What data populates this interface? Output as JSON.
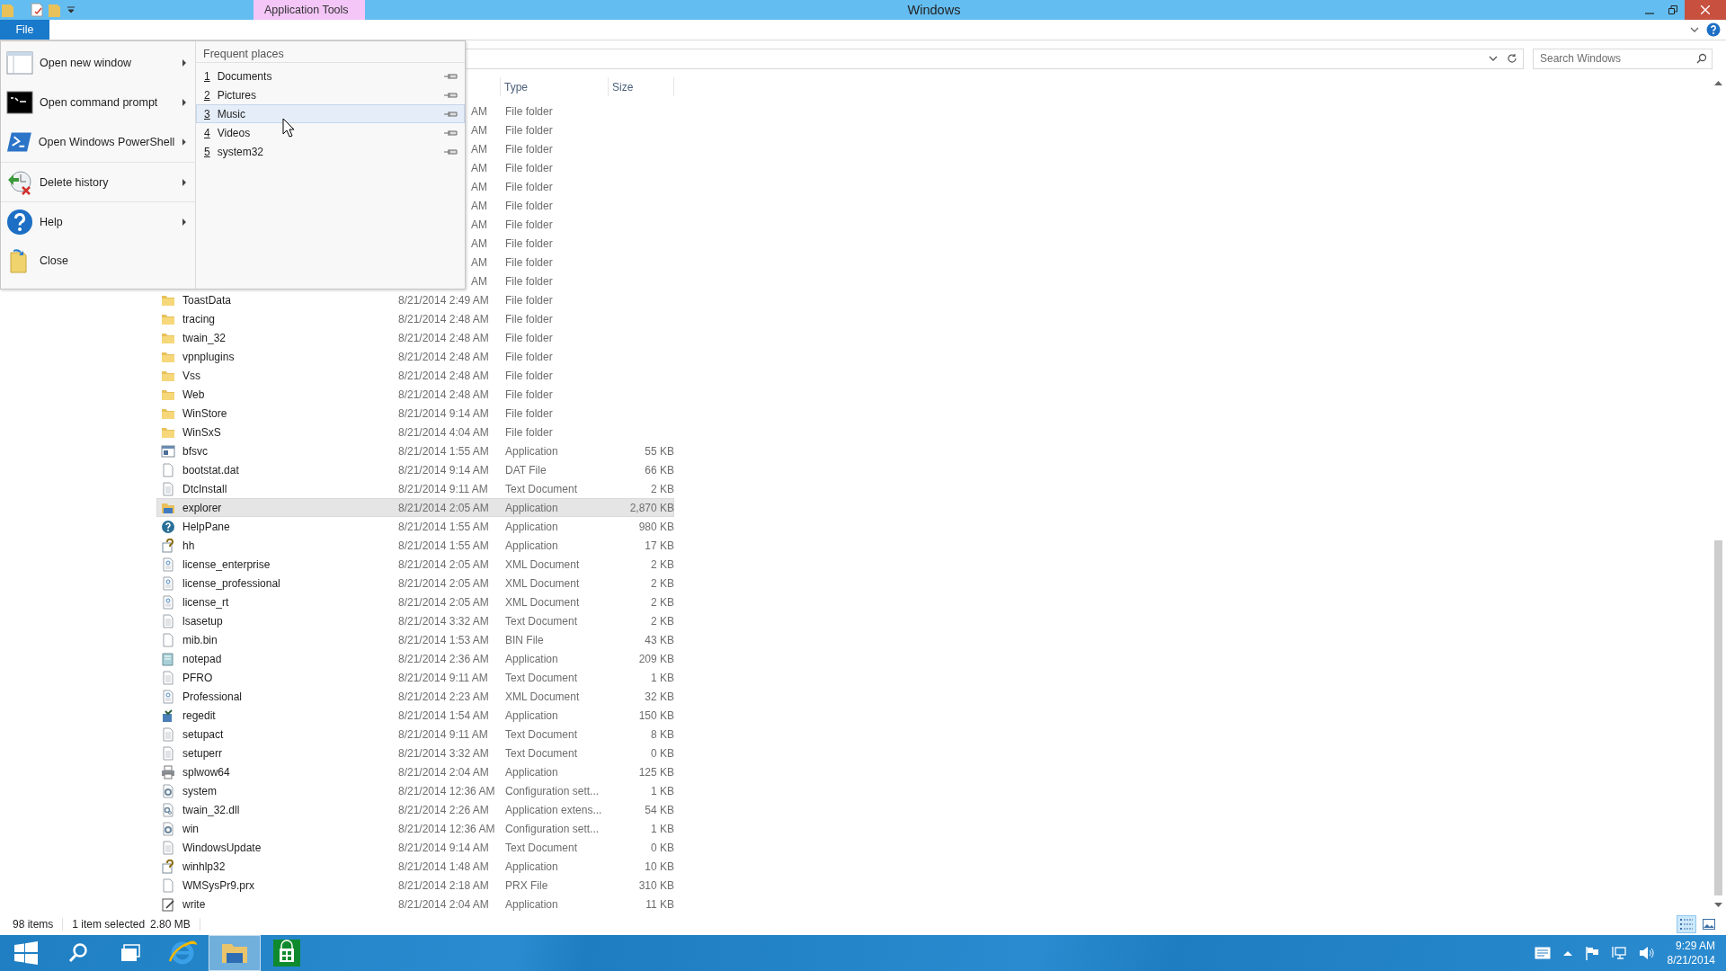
{
  "window": {
    "title": "Windows",
    "context_tab": "Application Tools"
  },
  "ribbon": {
    "file_tab": "File"
  },
  "search": {
    "placeholder": "Search Windows"
  },
  "columns": [
    {
      "label": "Type"
    },
    {
      "label": "Size"
    }
  ],
  "rows": [
    {
      "covered": true,
      "date": "AM",
      "type": "File folder",
      "selected": false
    },
    {
      "covered": true,
      "date": "AM",
      "type": "File folder",
      "selected": false
    },
    {
      "covered": true,
      "date": "AM",
      "type": "File folder",
      "selected": false
    },
    {
      "covered": true,
      "date": "AM",
      "type": "File folder",
      "selected": false
    },
    {
      "covered": true,
      "date": "AM",
      "type": "File folder",
      "selected": false
    },
    {
      "covered": true,
      "date": "AM",
      "type": "File folder",
      "selected": false
    },
    {
      "covered": true,
      "date": "AM",
      "type": "File folder",
      "selected": false
    },
    {
      "covered": true,
      "date": "AM",
      "type": "File folder",
      "selected": false
    },
    {
      "covered": true,
      "date": "AM",
      "type": "File folder",
      "selected": false
    },
    {
      "covered": true,
      "date": "AM",
      "type": "File folder",
      "selected": false
    },
    {
      "kind": "folder",
      "covered": false,
      "name": "ToastData",
      "date": "8/21/2014 2:49 AM",
      "type": "File folder",
      "selected": false
    },
    {
      "kind": "folder",
      "covered": false,
      "name": "tracing",
      "date": "8/21/2014 2:48 AM",
      "type": "File folder",
      "selected": false
    },
    {
      "kind": "folder",
      "covered": false,
      "name": "twain_32",
      "date": "8/21/2014 2:48 AM",
      "type": "File folder",
      "selected": false
    },
    {
      "kind": "folder",
      "covered": false,
      "name": "vpnplugins",
      "date": "8/21/2014 2:48 AM",
      "type": "File folder",
      "selected": false
    },
    {
      "kind": "folder",
      "covered": false,
      "name": "Vss",
      "date": "8/21/2014 2:48 AM",
      "type": "File folder",
      "selected": false
    },
    {
      "kind": "folder",
      "covered": false,
      "name": "Web",
      "date": "8/21/2014 2:48 AM",
      "type": "File folder",
      "selected": false
    },
    {
      "kind": "folder",
      "covered": false,
      "name": "WinStore",
      "date": "8/21/2014 9:14 AM",
      "type": "File folder",
      "selected": false
    },
    {
      "kind": "folder",
      "covered": false,
      "name": "WinSxS",
      "date": "8/21/2014 4:04 AM",
      "type": "File folder",
      "selected": false
    },
    {
      "kind": "app",
      "covered": false,
      "name": "bfsvc",
      "date": "8/21/2014 1:55 AM",
      "type": "Application",
      "size": "55 KB",
      "selected": false
    },
    {
      "kind": "blank",
      "covered": false,
      "name": "bootstat.dat",
      "date": "8/21/2014 9:14 AM",
      "type": "DAT File",
      "size": "66 KB",
      "selected": false
    },
    {
      "kind": "text",
      "covered": false,
      "name": "DtcInstall",
      "date": "8/21/2014 9:11 AM",
      "type": "Text Document",
      "size": "2 KB",
      "selected": false
    },
    {
      "kind": "explorer",
      "covered": false,
      "name": "explorer",
      "date": "8/21/2014 2:05 AM",
      "type": "Application",
      "size": "2,870 KB",
      "selected": true
    },
    {
      "kind": "help",
      "covered": false,
      "name": "HelpPane",
      "date": "8/21/2014 1:55 AM",
      "type": "Application",
      "size": "980 KB",
      "selected": false
    },
    {
      "kind": "hh",
      "covered": false,
      "name": "hh",
      "date": "8/21/2014 1:55 AM",
      "type": "Application",
      "size": "17 KB",
      "selected": false
    },
    {
      "kind": "xml",
      "covered": false,
      "name": "license_enterprise",
      "date": "8/21/2014 2:05 AM",
      "type": "XML Document",
      "size": "2 KB",
      "selected": false
    },
    {
      "kind": "xml",
      "covered": false,
      "name": "license_professional",
      "date": "8/21/2014 2:05 AM",
      "type": "XML Document",
      "size": "2 KB",
      "selected": false
    },
    {
      "kind": "xml",
      "covered": false,
      "name": "license_rt",
      "date": "8/21/2014 2:05 AM",
      "type": "XML Document",
      "size": "2 KB",
      "selected": false
    },
    {
      "kind": "text",
      "covered": false,
      "name": "lsasetup",
      "date": "8/21/2014 3:32 AM",
      "type": "Text Document",
      "size": "2 KB",
      "selected": false
    },
    {
      "kind": "blank",
      "covered": false,
      "name": "mib.bin",
      "date": "8/21/2014 1:53 AM",
      "type": "BIN File",
      "size": "43 KB",
      "selected": false
    },
    {
      "kind": "notepad",
      "covered": false,
      "name": "notepad",
      "date": "8/21/2014 2:36 AM",
      "type": "Application",
      "size": "209 KB",
      "selected": false
    },
    {
      "kind": "text",
      "covered": false,
      "name": "PFRO",
      "date": "8/21/2014 9:11 AM",
      "type": "Text Document",
      "size": "1 KB",
      "selected": false
    },
    {
      "kind": "xml",
      "covered": false,
      "name": "Professional",
      "date": "8/21/2014 2:23 AM",
      "type": "XML Document",
      "size": "32 KB",
      "selected": false
    },
    {
      "kind": "registry",
      "covered": false,
      "name": "regedit",
      "date": "8/21/2014 1:54 AM",
      "type": "Application",
      "size": "150 KB",
      "selected": false
    },
    {
      "kind": "text",
      "covered": false,
      "name": "setupact",
      "date": "8/21/2014 9:11 AM",
      "type": "Text Document",
      "size": "8 KB",
      "selected": false
    },
    {
      "kind": "text",
      "covered": false,
      "name": "setuperr",
      "date": "8/21/2014 3:32 AM",
      "type": "Text Document",
      "size": "0 KB",
      "selected": false
    },
    {
      "kind": "printer",
      "covered": false,
      "name": "splwow64",
      "date": "8/21/2014 2:04 AM",
      "type": "Application",
      "size": "125 KB",
      "selected": false
    },
    {
      "kind": "config",
      "covered": false,
      "name": "system",
      "date": "8/21/2014 12:36 AM",
      "type": "Configuration sett...",
      "size": "1 KB",
      "selected": false
    },
    {
      "kind": "dll",
      "covered": false,
      "name": "twain_32.dll",
      "date": "8/21/2014 2:26 AM",
      "type": "Application extens...",
      "size": "54 KB",
      "selected": false
    },
    {
      "kind": "config",
      "covered": false,
      "name": "win",
      "date": "8/21/2014 12:36 AM",
      "type": "Configuration sett...",
      "size": "1 KB",
      "selected": false
    },
    {
      "kind": "text",
      "covered": false,
      "name": "WindowsUpdate",
      "date": "8/21/2014 9:14 AM",
      "type": "Text Document",
      "size": "0 KB",
      "selected": false
    },
    {
      "kind": "hh",
      "covered": false,
      "name": "winhlp32",
      "date": "8/21/2014 1:48 AM",
      "type": "Application",
      "size": "10 KB",
      "selected": false
    },
    {
      "kind": "blank",
      "covered": false,
      "name": "WMSysPr9.prx",
      "date": "8/21/2014 2:18 AM",
      "type": "PRX File",
      "size": "310 KB",
      "selected": false
    },
    {
      "kind": "write",
      "covered": false,
      "name": "write",
      "date": "8/21/2014 2:04 AM",
      "type": "Application",
      "size": "11 KB",
      "selected": false
    }
  ],
  "status_bar": {
    "items": "98 items",
    "selection": "1 item selected",
    "selection_size": "2.80 MB"
  },
  "views": [
    {
      "kind": "details",
      "selected": true
    },
    {
      "kind": "large-icons",
      "selected": false
    }
  ],
  "file_menu": {
    "commands": [
      {
        "kind": "window",
        "label": "Open new window",
        "submenu": true
      },
      {
        "kind": "cmd",
        "label": "Open command prompt",
        "submenu": true
      },
      {
        "kind": "powershell",
        "label": "Open Windows PowerShell",
        "submenu": true
      },
      {
        "kind": "history",
        "label": "Delete history",
        "submenu": true
      },
      {
        "kind": "help",
        "label": "Help",
        "submenu": true
      },
      {
        "kind": "close",
        "label": "Close",
        "submenu": false
      }
    ],
    "frequent_title": "Frequent places",
    "places": [
      {
        "number": "1",
        "label": "Documents",
        "selected": false
      },
      {
        "number": "2",
        "label": "Pictures",
        "selected": false
      },
      {
        "number": "3",
        "label": "Music",
        "selected": true
      },
      {
        "number": "4",
        "label": "Videos",
        "selected": false
      },
      {
        "number": "5",
        "label": "system32",
        "selected": false
      }
    ]
  },
  "taskbar": {
    "apps": [
      {
        "kind": "start",
        "active": false
      },
      {
        "kind": "search",
        "active": false
      },
      {
        "kind": "taskview",
        "active": false
      },
      {
        "kind": "ie",
        "active": false
      },
      {
        "kind": "explorer",
        "active": true
      },
      {
        "kind": "store",
        "active": false
      }
    ],
    "time": "9:29 AM",
    "date": "8/21/2014"
  }
}
